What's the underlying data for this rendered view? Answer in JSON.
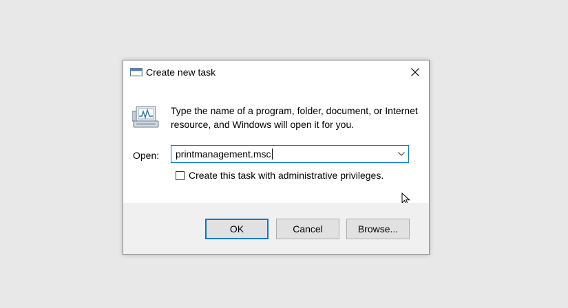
{
  "dialog": {
    "title": "Create new task",
    "description": "Type the name of a program, folder, document, or Internet resource, and Windows will open it for you.",
    "open_label": "Open:",
    "open_value": "printmanagement.msc",
    "admin_checkbox_label": "Create this task with administrative privileges.",
    "admin_checked": false
  },
  "buttons": {
    "ok": "OK",
    "cancel": "Cancel",
    "browse": "Browse..."
  },
  "colors": {
    "accent": "#0078d7",
    "footer_bg": "#f0f0f0",
    "page_bg": "#e8e8e8"
  }
}
